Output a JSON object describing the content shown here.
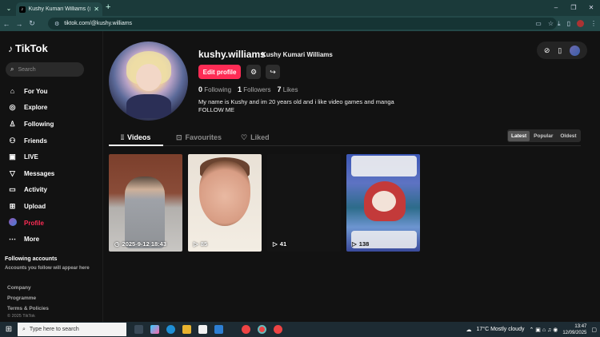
{
  "browser": {
    "tab_title": "Kushy Kumari Williams (@kushy.williams)",
    "new_tab": "+",
    "url": "tiktok.com/@kushy.williams",
    "window_controls": [
      "–",
      "❐",
      "✕"
    ]
  },
  "sidebar": {
    "brand": "TikTok",
    "search_placeholder": "Search",
    "items": [
      {
        "label": "For You",
        "icon": "home-icon"
      },
      {
        "label": "Explore",
        "icon": "compass-icon"
      },
      {
        "label": "Following",
        "icon": "users-icon"
      },
      {
        "label": "Friends",
        "icon": "friends-icon"
      },
      {
        "label": "LIVE",
        "icon": "live-icon"
      },
      {
        "label": "Messages",
        "icon": "send-icon"
      },
      {
        "label": "Activity",
        "icon": "message-icon"
      },
      {
        "label": "Upload",
        "icon": "plus-icon"
      },
      {
        "label": "Profile",
        "icon": "avatar-icon"
      },
      {
        "label": "More",
        "icon": "more-icon"
      }
    ],
    "following_accounts_title": "Following accounts",
    "following_accounts_hint": "Accounts you follow will appear here",
    "footer_links": [
      "Company",
      "Programme",
      "Terms & Policies"
    ],
    "copyright": "© 2025 TikTok"
  },
  "profile": {
    "username": "kushy.williams",
    "display_name": "Kushy Kumari Williams",
    "edit_button": "Edit profile",
    "stats": {
      "following_count": "0",
      "following_label": "Following",
      "followers_count": "1",
      "followers_label": "Followers",
      "likes_count": "7",
      "likes_label": "Likes"
    },
    "bio_line1": "My name is Kushy and im 20 years old and i like video games and manga",
    "bio_line2": "FOLLOW ME"
  },
  "tabs": [
    {
      "label": "Videos",
      "active": true
    },
    {
      "label": "Favourites",
      "active": false
    },
    {
      "label": "Liked",
      "active": false
    }
  ],
  "sort_options": [
    {
      "label": "Latest",
      "active": true
    },
    {
      "label": "Popular",
      "active": false
    },
    {
      "label": "Oldest",
      "active": false
    }
  ],
  "videos": [
    {
      "label": "2025-9-12 18:43",
      "kind": "date"
    },
    {
      "label": "85",
      "kind": "views"
    },
    {
      "label": "41",
      "kind": "views"
    },
    {
      "label": "138",
      "kind": "views"
    }
  ],
  "taskbar": {
    "search_placeholder": "Type here to search",
    "weather": "17°C  Mostly cloudy",
    "time": "13:47",
    "date": "12/09/2025"
  },
  "colors": {
    "accent": "#fe2c55",
    "background": "#121212",
    "browser_frame": "#1b3a3a"
  }
}
